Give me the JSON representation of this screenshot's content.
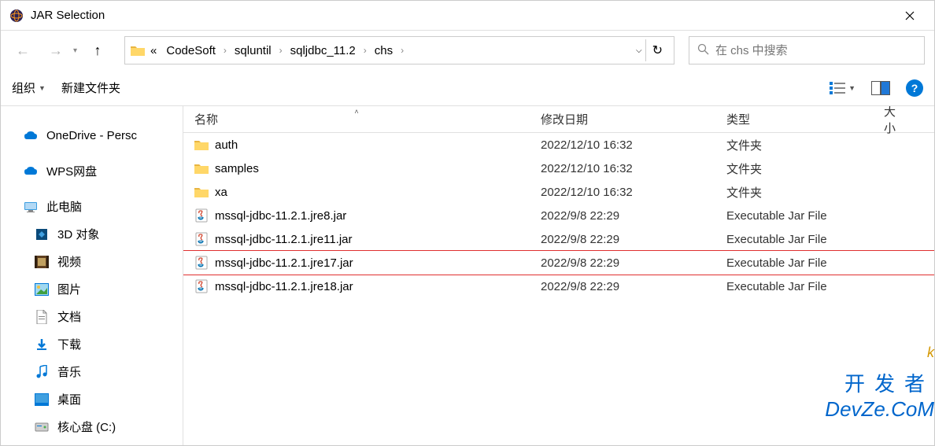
{
  "window": {
    "title": "JAR Selection"
  },
  "breadcrumb": {
    "prefix": "«",
    "parts": [
      "CodeSoft",
      "sqluntil",
      "sqljdbc_11.2",
      "chs"
    ]
  },
  "search": {
    "placeholder": "在 chs 中搜索"
  },
  "toolbar": {
    "organize": "组织",
    "new_folder": "新建文件夹"
  },
  "sidebar": {
    "items": [
      {
        "label": "OneDrive - Persc",
        "icon": "cloud-blue",
        "indent": false
      },
      {
        "label": "WPS网盘",
        "icon": "cloud-blue",
        "indent": false
      },
      {
        "label": "此电脑",
        "icon": "computer",
        "indent": false
      },
      {
        "label": "3D 对象",
        "icon": "3d",
        "indent": true
      },
      {
        "label": "视频",
        "icon": "video",
        "indent": true
      },
      {
        "label": "图片",
        "icon": "pictures",
        "indent": true
      },
      {
        "label": "文档",
        "icon": "documents",
        "indent": true
      },
      {
        "label": "下载",
        "icon": "downloads",
        "indent": true
      },
      {
        "label": "音乐",
        "icon": "music",
        "indent": true
      },
      {
        "label": "桌面",
        "icon": "desktop",
        "indent": true
      },
      {
        "label": "核心盘 (C:)",
        "icon": "disk",
        "indent": true
      }
    ]
  },
  "columns": {
    "name": "名称",
    "date": "修改日期",
    "type": "类型",
    "size": "大小"
  },
  "files": [
    {
      "name": "auth",
      "date": "2022/12/10 16:32",
      "type": "文件夹",
      "icon": "folder"
    },
    {
      "name": "samples",
      "date": "2022/12/10 16:32",
      "type": "文件夹",
      "icon": "folder"
    },
    {
      "name": "xa",
      "date": "2022/12/10 16:32",
      "type": "文件夹",
      "icon": "folder"
    },
    {
      "name": "mssql-jdbc-11.2.1.jre8.jar",
      "date": "2022/9/8 22:29",
      "type": "Executable Jar File",
      "icon": "jar"
    },
    {
      "name": "mssql-jdbc-11.2.1.jre11.jar",
      "date": "2022/9/8 22:29",
      "type": "Executable Jar File",
      "icon": "jar"
    },
    {
      "name": "mssql-jdbc-11.2.1.jre17.jar",
      "date": "2022/9/8 22:29",
      "type": "Executable Jar File",
      "icon": "jar",
      "highlighted": true
    },
    {
      "name": "mssql-jdbc-11.2.1.jre18.jar",
      "date": "2022/9/8 22:29",
      "type": "Executable Jar File",
      "icon": "jar"
    }
  ],
  "watermark": {
    "line1": "开发者",
    "line2": "DevZe.CoM"
  }
}
